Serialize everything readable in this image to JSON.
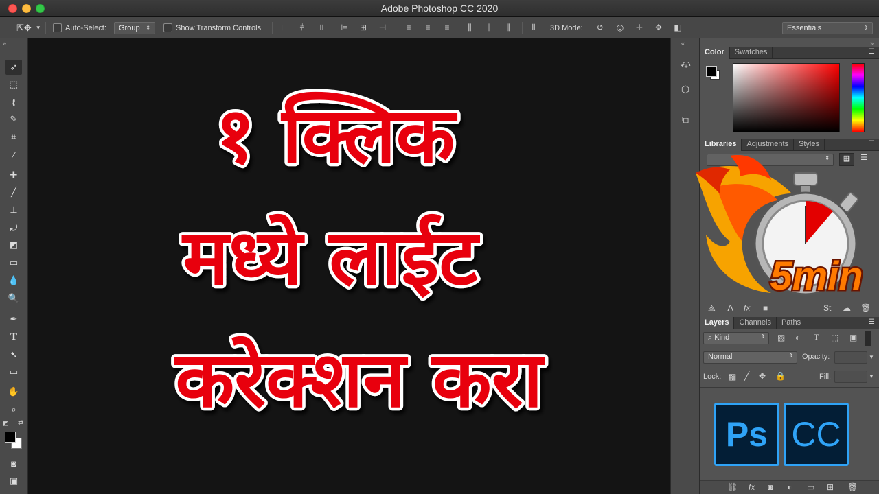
{
  "window": {
    "title": "Adobe Photoshop CC 2020"
  },
  "options_bar": {
    "auto_select_label": "Auto-Select:",
    "auto_select_value": "Group",
    "transform_label": "Show Transform Controls",
    "mode_3d_label": "3D Mode:",
    "workspace_value": "Essentials"
  },
  "canvas": {
    "headline_lines": [
      "१ क्लिक",
      "मध्ये लाईट",
      "करेक्शन करा"
    ],
    "colors": {
      "text": "#e8000d",
      "outline": "#ffffff",
      "background": "#141414"
    }
  },
  "badge": {
    "text": "5min"
  },
  "panels": {
    "color_tabs": [
      "Color",
      "Swatches"
    ],
    "libraries_tabs": [
      "Libraries",
      "Adjustments",
      "Styles"
    ],
    "layers_tabs": [
      "Layers",
      "Channels",
      "Paths"
    ],
    "kind_value": "Kind",
    "blend_mode_value": "Normal",
    "opacity_label": "Opacity:",
    "lock_label": "Lock:",
    "fill_label": "Fill:"
  },
  "logo": {
    "ps": "Ps",
    "cc": "CC",
    "color": "#2fa3f7"
  }
}
